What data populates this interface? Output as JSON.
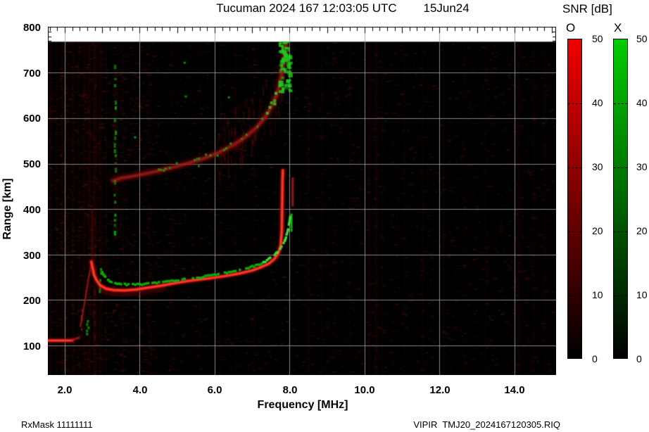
{
  "title": "Tucuman 2024 167 12:03:05 UTC        15Jun24",
  "footer": {
    "left": "RxMask 11111111",
    "right": "VIPIR  TMJ20_2024167120305.RIQ"
  },
  "chart_data": {
    "type": "heatmap",
    "subtype": "ionogram",
    "title": "Tucuman 2024 167 12:03:05 UTC        15Jun24",
    "station": "Tucuman",
    "x_axis": {
      "label": "Frequency [MHz]",
      "range": [
        1.55,
        15.11
      ],
      "ticks": [
        2,
        4,
        6,
        8,
        10,
        12,
        14
      ],
      "tick_labels": [
        "2.0",
        "4.0",
        "6.0",
        "8.0",
        "10.0",
        "12.0",
        "14.0"
      ],
      "minor_tick_step": 0.2
    },
    "y_axis": {
      "label": "Range [km]",
      "range": [
        35,
        801
      ],
      "grid_km": [
        700,
        600,
        500,
        400,
        300,
        200,
        100
      ],
      "ticks": [
        800,
        700,
        600,
        500,
        400,
        300,
        200,
        100
      ],
      "tick_labels": [
        "800",
        "700",
        "600",
        "500",
        "400",
        "300",
        "200",
        "100"
      ],
      "data_top_km": 768
    },
    "colorbar": {
      "title": "SNR [dB]",
      "o_label": "O",
      "x_label": "X",
      "ticks": [
        50,
        40,
        30,
        20,
        10,
        0
      ],
      "tick_labels": [
        "50",
        "40",
        "30",
        "20",
        "10",
        "0"
      ],
      "o_color_top": "#f00000",
      "x_color_top": "#00cc00",
      "color_bottom": "#000000"
    },
    "colors": {
      "background": "#000000",
      "grid": "rgba(158,158,158,0.85)",
      "o_trace": "#d02020",
      "x_trace": "#00c000"
    },
    "traces": {
      "f_layer_o": [
        [
          2.71,
          284
        ],
        [
          2.78,
          256
        ],
        [
          2.85,
          243
        ],
        [
          2.95,
          232
        ],
        [
          3.1,
          225
        ],
        [
          3.3,
          222
        ],
        [
          3.6,
          221
        ],
        [
          3.9,
          223
        ],
        [
          4.2,
          227
        ],
        [
          4.6,
          232
        ],
        [
          5.0,
          238
        ],
        [
          5.4,
          243
        ],
        [
          5.9,
          248
        ],
        [
          6.3,
          253
        ],
        [
          6.7,
          259
        ],
        [
          7.0,
          265
        ],
        [
          7.2,
          271
        ],
        [
          7.45,
          280
        ],
        [
          7.6,
          291
        ],
        [
          7.7,
          303
        ],
        [
          7.76,
          320
        ],
        [
          7.79,
          350
        ],
        [
          7.8,
          400
        ],
        [
          7.81,
          460
        ],
        [
          7.82,
          485
        ]
      ],
      "f_layer_x": [
        [
          3.0,
          262
        ],
        [
          3.08,
          250
        ],
        [
          3.2,
          242
        ],
        [
          3.4,
          236
        ],
        [
          3.7,
          234
        ],
        [
          4.0,
          234
        ],
        [
          4.4,
          237
        ],
        [
          4.8,
          241
        ],
        [
          5.2,
          246
        ],
        [
          5.7,
          251
        ],
        [
          6.1,
          257
        ],
        [
          6.5,
          263
        ],
        [
          6.9,
          271
        ],
        [
          7.15,
          277
        ],
        [
          7.4,
          287
        ],
        [
          7.6,
          299
        ],
        [
          7.75,
          313
        ],
        [
          7.87,
          330
        ],
        [
          7.95,
          352
        ],
        [
          8.0,
          375
        ],
        [
          8.03,
          392
        ]
      ],
      "second_hop_o": [
        [
          3.3,
          462
        ],
        [
          3.5,
          468
        ],
        [
          3.8,
          472
        ],
        [
          4.1,
          477
        ],
        [
          4.5,
          484
        ],
        [
          4.9,
          492
        ],
        [
          5.3,
          501
        ],
        [
          5.7,
          511
        ],
        [
          6.1,
          524
        ],
        [
          6.5,
          541
        ],
        [
          6.8,
          557
        ],
        [
          7.1,
          578
        ],
        [
          7.35,
          602
        ],
        [
          7.55,
          630
        ],
        [
          7.7,
          662
        ],
        [
          7.8,
          700
        ],
        [
          7.86,
          735
        ],
        [
          7.9,
          762
        ]
      ],
      "leading_arc_o": [
        [
          2.42,
          142
        ],
        [
          2.5,
          180
        ],
        [
          2.57,
          214
        ],
        [
          2.63,
          246
        ],
        [
          2.69,
          270
        ],
        [
          2.71,
          284
        ]
      ],
      "o_asymptote_dash": {
        "f": 8.08,
        "km_from": 408,
        "km_to": 468
      },
      "x_asymptote_dash": {
        "f": 8.05,
        "km_from": 358,
        "km_to": 392
      }
    },
    "features": {
      "e_band": {
        "km": 111,
        "f_from": 1.55,
        "f_to": 2.38
      },
      "green_dashed_vertical": {
        "f": 3.35,
        "km_from": 330,
        "km_to": 720
      },
      "green_dashes_leading": {
        "f": 2.95,
        "km_from": 222,
        "km_to": 272
      },
      "green_dashes_low": {
        "f": 2.6,
        "km_from": 128,
        "km_to": 158
      },
      "red_dashes_low": {
        "f": 2.45,
        "km_from": 138,
        "km_to": 185
      },
      "red_faint_vertical": {
        "f": 2.73,
        "km_from": 284,
        "km_to": 400
      },
      "red_dash_column": {
        "f": 2.8,
        "km_from": 120,
        "km_to": 400
      },
      "second_hop_green_blob": {
        "f_from": 7.7,
        "f_to": 7.98,
        "km_from": 660,
        "km_to": 772
      }
    },
    "noise": {
      "stripes": [
        [
          1.62,
          0.1
        ],
        [
          1.78,
          0.07
        ],
        [
          1.92,
          0.12
        ],
        [
          2.06,
          0.08
        ],
        [
          2.22,
          0.09
        ],
        [
          2.38,
          0.06
        ],
        [
          2.52,
          0.1
        ],
        [
          2.65,
          0.12
        ],
        [
          2.8,
          0.15
        ],
        [
          2.95,
          0.1
        ],
        [
          3.1,
          0.07
        ],
        [
          3.55,
          0.05
        ],
        [
          4.25,
          0.05
        ],
        [
          4.85,
          0.05
        ],
        [
          5.6,
          0.04
        ],
        [
          6.15,
          0.05
        ],
        [
          6.55,
          0.04
        ],
        [
          7.05,
          0.05
        ],
        [
          8.5,
          0.06
        ],
        [
          8.85,
          0.05
        ],
        [
          9.2,
          0.05
        ],
        [
          9.6,
          0.04
        ],
        [
          10.12,
          0.13
        ],
        [
          10.3,
          0.09
        ],
        [
          10.48,
          0.05
        ],
        [
          11.05,
          0.04
        ],
        [
          11.55,
          0.05
        ],
        [
          12.1,
          0.04
        ],
        [
          12.65,
          0.04
        ],
        [
          13.25,
          0.04
        ],
        [
          14.1,
          0.08
        ],
        [
          14.5,
          0.05
        ],
        [
          14.8,
          0.06
        ]
      ],
      "green_specks": [
        [
          5.17,
          724
        ],
        [
          5.2,
          650
        ],
        [
          6.35,
          648
        ],
        [
          3.85,
          560
        ],
        [
          4.62,
          487
        ],
        [
          5.55,
          497
        ],
        [
          6.05,
          520
        ]
      ]
    }
  }
}
